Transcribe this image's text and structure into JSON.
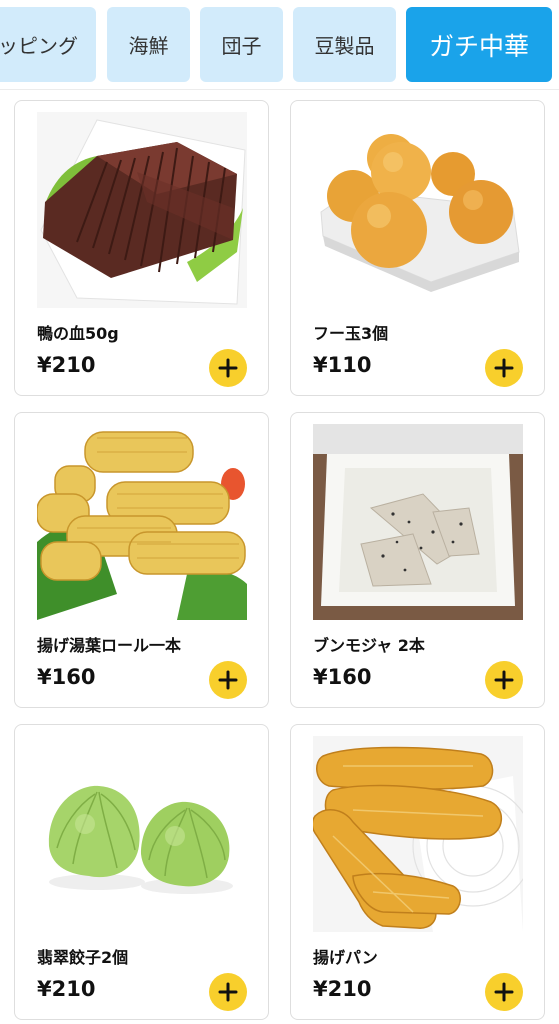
{
  "tabs": [
    {
      "label": "トッピング",
      "active": false
    },
    {
      "label": "海鮮",
      "active": false
    },
    {
      "label": "団子",
      "active": false
    },
    {
      "label": "豆製品",
      "active": false
    },
    {
      "label": "ガチ中華",
      "active": true
    }
  ],
  "colors": {
    "tab_bg": "#d2ebfb",
    "tab_active_bg": "#1aa3ea",
    "add_button": "#f8cf2c",
    "card_border": "#dedede"
  },
  "products": [
    {
      "name": "鴨の血50g",
      "price": "¥210",
      "image": "duck-blood-photo",
      "add_icon": "plus-icon"
    },
    {
      "name": "フー玉3個",
      "price": "¥110",
      "image": "fried-balls-photo",
      "add_icon": "plus-icon"
    },
    {
      "name": "揚げ湯葉ロール一本",
      "price": "¥160",
      "image": "fried-yuba-roll-photo",
      "add_icon": "plus-icon"
    },
    {
      "name": "ブンモジャ 2本",
      "price": "¥160",
      "image": "konjac-slices-photo",
      "add_icon": "plus-icon"
    },
    {
      "name": "翡翠餃子2個",
      "price": "¥210",
      "image": "jade-dumplings-photo",
      "add_icon": "plus-icon"
    },
    {
      "name": "揚げパン",
      "price": "¥210",
      "image": "fried-dough-sticks-photo",
      "add_icon": "plus-icon"
    }
  ]
}
